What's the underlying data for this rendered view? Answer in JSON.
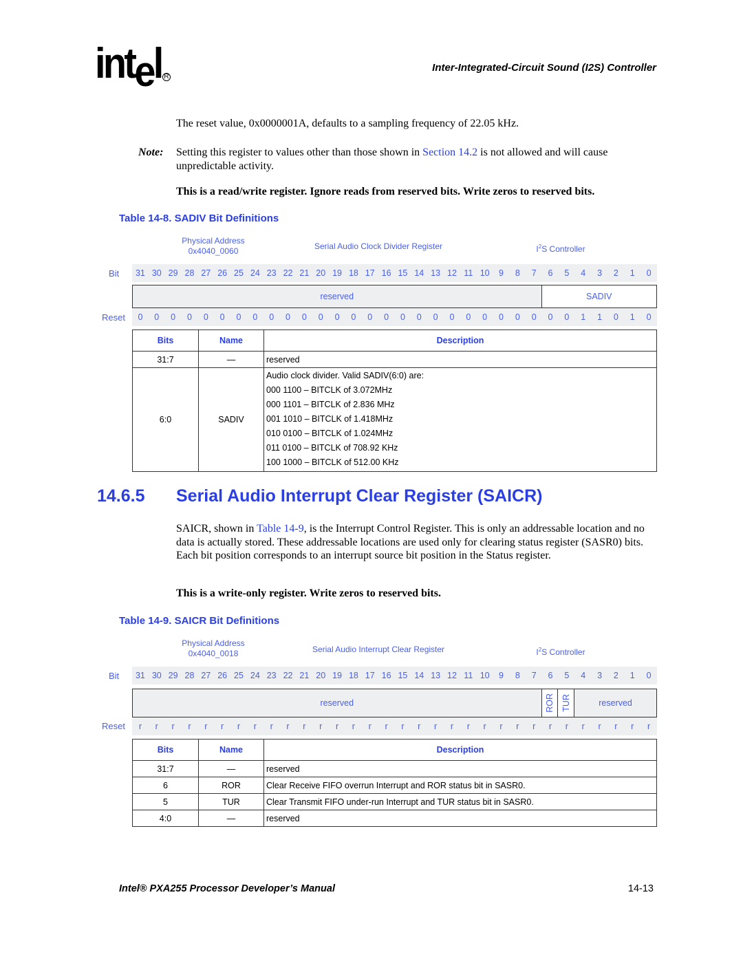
{
  "header": {
    "logo_text": "int",
    "logo_e": "e",
    "logo_l": "l",
    "registered_mark": "R",
    "chapter_title": "Inter-Integrated-Circuit Sound (I2S) Controller"
  },
  "intro": {
    "reset_text": "The reset value, 0x0000001A, defaults to a sampling frequency of 22.05 kHz.",
    "note_label": "Note:",
    "note_pre": "Setting this register to values other than those shown in ",
    "note_link": "Section 14.2",
    "note_post": " is not allowed and will cause unpredictable activity.",
    "rw_text": "This is a read/write register. Ignore reads from reserved bits. Write zeros to reserved bits."
  },
  "table8": {
    "caption": "Table 14-8. SADIV Bit Definitions",
    "reg": {
      "phys_label": "Physical Address",
      "phys_addr": "0x4040_0060",
      "name": "Serial Audio Clock Divider Register",
      "unit_sup": "2",
      "unit_pre": "I",
      "unit_post": "S Controller",
      "bit_label": "Bit",
      "reset_label": "Reset",
      "bits": [
        "31",
        "30",
        "29",
        "28",
        "27",
        "26",
        "25",
        "24",
        "23",
        "22",
        "21",
        "20",
        "19",
        "18",
        "17",
        "16",
        "15",
        "14",
        "13",
        "12",
        "11",
        "10",
        "9",
        "8",
        "7",
        "6",
        "5",
        "4",
        "3",
        "2",
        "1",
        "0"
      ],
      "fields": [
        {
          "label": "reserved",
          "span": 25
        },
        {
          "label": "SADIV",
          "span": 7
        }
      ],
      "reset": [
        "0",
        "0",
        "0",
        "0",
        "0",
        "0",
        "0",
        "0",
        "0",
        "0",
        "0",
        "0",
        "0",
        "0",
        "0",
        "0",
        "0",
        "0",
        "0",
        "0",
        "0",
        "0",
        "0",
        "0",
        "0",
        "0",
        "0",
        "1",
        "1",
        "0",
        "1",
        "0"
      ]
    },
    "headers": [
      "Bits",
      "Name",
      "Description"
    ],
    "rows": [
      {
        "bits": "31:7",
        "name": "—",
        "desc": [
          "reserved"
        ]
      },
      {
        "bits": "6:0",
        "name": "SADIV",
        "desc": [
          "Audio clock divider. Valid SADIV(6:0) are:",
          "000 1100 – BITCLK of 3.072MHz",
          "000 1101 – BITCLK of 2.836 MHz",
          "001 1010 – BITCLK of 1.418MHz",
          "010 0100 – BITCLK of 1.024MHz",
          "011 0100 – BITCLK of 708.92 KHz",
          "100 1000 – BITCLK of 512.00 KHz"
        ]
      }
    ]
  },
  "section": {
    "number": "14.6.5",
    "title": "Serial Audio Interrupt Clear Register (SAICR)",
    "body_pre": "SAICR, shown in ",
    "body_link": "Table 14-9",
    "body_post": ", is the Interrupt Control Register. This is only an addressable location and no data is actually stored. These addressable locations are used only for clearing status register (SASR0) bits. Each bit position corresponds to an interrupt source bit position in the Status register.",
    "wo_text": "This is a write-only register. Write zeros to reserved bits."
  },
  "table9": {
    "caption": "Table 14-9. SAICR Bit Definitions",
    "reg": {
      "phys_label": "Physical Address",
      "phys_addr": "0x4040_0018",
      "name": "Serial Audio Interrupt Clear Register",
      "unit_sup": "2",
      "unit_pre": "I",
      "unit_post": "S Controller",
      "bit_label": "Bit",
      "reset_label": "Reset",
      "bits": [
        "31",
        "30",
        "29",
        "28",
        "27",
        "26",
        "25",
        "24",
        "23",
        "22",
        "21",
        "20",
        "19",
        "18",
        "17",
        "16",
        "15",
        "14",
        "13",
        "12",
        "11",
        "10",
        "9",
        "8",
        "7",
        "6",
        "5",
        "4",
        "3",
        "2",
        "1",
        "0"
      ],
      "fields": [
        {
          "label": "reserved",
          "span": 25
        },
        {
          "label": "ROR",
          "span": 1
        },
        {
          "label": "TUR",
          "span": 1
        },
        {
          "label": "reserved",
          "span": 5
        }
      ],
      "reset": [
        "r",
        "r",
        "r",
        "r",
        "r",
        "r",
        "r",
        "r",
        "r",
        "r",
        "r",
        "r",
        "r",
        "r",
        "r",
        "r",
        "r",
        "r",
        "r",
        "r",
        "r",
        "r",
        "r",
        "r",
        "r",
        "r",
        "r",
        "r",
        "r",
        "r",
        "r",
        "r"
      ]
    },
    "headers": [
      "Bits",
      "Name",
      "Description"
    ],
    "rows": [
      {
        "bits": "31:7",
        "name": "—",
        "desc": [
          "reserved"
        ]
      },
      {
        "bits": "6",
        "name": "ROR",
        "desc": [
          "Clear Receive FIFO overrun Interrupt and ROR status bit in SASR0."
        ]
      },
      {
        "bits": "5",
        "name": "TUR",
        "desc": [
          "Clear Transmit FIFO under-run Interrupt and TUR status bit in SASR0."
        ]
      },
      {
        "bits": "4:0",
        "name": "—",
        "desc": [
          "reserved"
        ]
      }
    ]
  },
  "footer": {
    "manual_title": "Intel® PXA255 Processor Developer’s Manual",
    "page_number": "14-13"
  }
}
